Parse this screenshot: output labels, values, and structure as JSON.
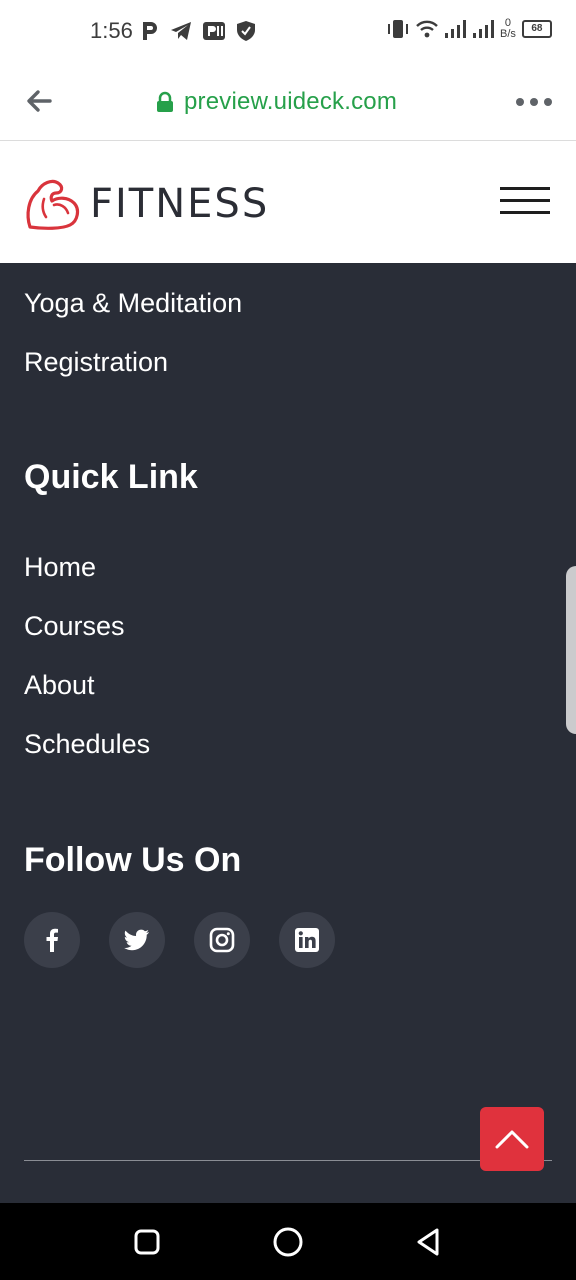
{
  "status_bar": {
    "time": "1:56",
    "net_speed_value": "0",
    "net_speed_unit": "B/s",
    "battery": "68"
  },
  "browser": {
    "url": "preview.uideck.com"
  },
  "site": {
    "logo_text": "FITNESS",
    "brand_color": "#d9343c"
  },
  "footer": {
    "course_links": [
      "Yoga & Meditation",
      "Registration"
    ],
    "quick_link_heading": "Quick Link",
    "quick_links": [
      "Home",
      "Courses",
      "About",
      "Schedules"
    ],
    "follow_heading": "Follow Us On",
    "socials": [
      "facebook-icon",
      "twitter-icon",
      "instagram-icon",
      "linkedin-icon"
    ],
    "background_color": "#292d37"
  }
}
